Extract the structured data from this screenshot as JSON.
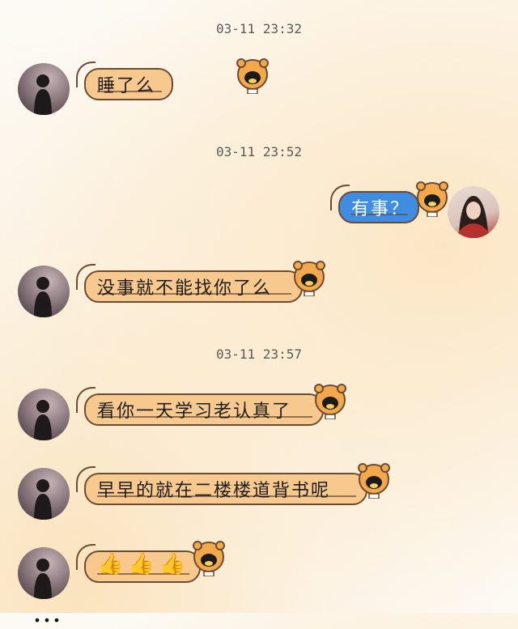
{
  "timestamps": [
    "03-11 23:32",
    "03-11 23:52",
    "03-11 23:57"
  ],
  "messages": [
    {
      "from": "other",
      "text": "睡了么"
    },
    {
      "from": "me",
      "text": "有事？"
    },
    {
      "from": "other",
      "text": "没事就不能找你了么"
    },
    {
      "from": "other",
      "text": "看你一天学习老认真了"
    },
    {
      "from": "other",
      "text": "早早的就在二楼楼道背书呢"
    },
    {
      "from": "other",
      "text": "👍👍👍"
    }
  ],
  "bottom_partial_text": "…"
}
